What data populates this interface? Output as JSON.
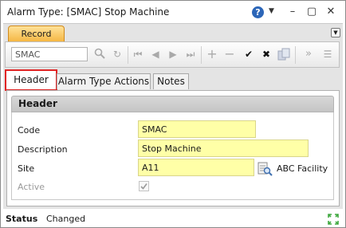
{
  "window": {
    "title": "Alarm Type: [SMAC] Stop Machine",
    "help_glyph": "?",
    "minimize_glyph": "–",
    "restore_glyph": "▢",
    "close_glyph": "✕"
  },
  "record_tab": {
    "label": "Record",
    "collapse_glyph": "▼"
  },
  "toolbar": {
    "search_value": "SMAC",
    "icons": [
      "search-icon",
      "refresh-icon",
      "first-record-icon",
      "previous-record-icon",
      "next-record-icon",
      "last-record-icon",
      "add-icon",
      "remove-icon",
      "confirm-icon",
      "cancel-icon",
      "copy-icon",
      "expand-icon",
      "menu-icon"
    ]
  },
  "tabs": [
    {
      "label": "Header",
      "selected": true
    },
    {
      "label": "Alarm Type Actions",
      "selected": false
    },
    {
      "label": "Notes",
      "selected": false
    }
  ],
  "section": {
    "title": "Header"
  },
  "form": {
    "code": {
      "label": "Code",
      "value": "SMAC"
    },
    "description": {
      "label": "Description",
      "value": "Stop Machine"
    },
    "site": {
      "label": "Site",
      "value": "A11",
      "lookup_text": "ABC Facility"
    },
    "active": {
      "label": "Active",
      "checked": true
    }
  },
  "status": {
    "label": "Status",
    "value": "Changed"
  },
  "colors": {
    "required_field_bg": "#ffffa7",
    "tab_highlight": "#e02424",
    "record_tab_bg": "#f5b744",
    "accent_blue": "#2c66b8"
  }
}
